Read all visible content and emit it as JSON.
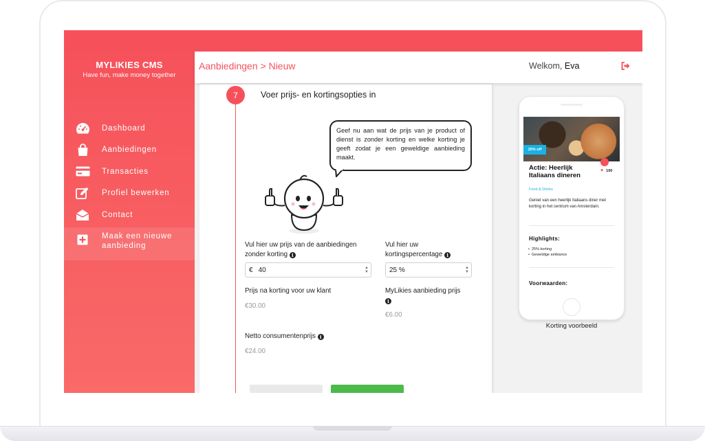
{
  "app": {
    "name": "MYLIKIES CMS",
    "tagline": "Have fun, make money together"
  },
  "sidebar": {
    "items": [
      {
        "label": "Dashboard",
        "icon": "speedometer-icon"
      },
      {
        "label": "Aanbiedingen",
        "icon": "shopping-bag-icon"
      },
      {
        "label": "Transacties",
        "icon": "credit-card-icon"
      },
      {
        "label": "Profiel bewerken",
        "icon": "edit-icon"
      },
      {
        "label": "Contact",
        "icon": "envelope-icon"
      }
    ],
    "new_offer_label": "Maak een nieuwe aanbieding"
  },
  "header": {
    "breadcrumb": "Aanbiedingen > Nieuw",
    "welcome_prefix": "Welkom,",
    "user_name": "Eva"
  },
  "step": {
    "number": "7",
    "title": "Voer prijs- en kortingsopties in",
    "speech": "Geef nu aan wat de prijs van je product of dienst is zonder korting en welke korting je geeft zodat je een geweldige aanbieding maakt."
  },
  "form": {
    "price_label": "Vul hier uw prijs van de aanbiedingen zonder korting",
    "currency_symbol": "€",
    "price_value": "40",
    "discount_label": "Vul hier uw kortingspercentage",
    "discount_value": "25 %",
    "price_after_label": "Prijs na korting voor uw klant",
    "price_after_value": "€30.00",
    "fee_label": "MyLikies aanbieding prijs",
    "fee_value": "€6.00",
    "net_label": "Netto consumentenprijs",
    "net_value": "€24.00"
  },
  "preview": {
    "discount_badge": "25% off",
    "likes": "100",
    "title": "Actie: Heerlijk Italiaans dineren",
    "category": "Food & Drinks",
    "description": "Geniet van een heerlijk Italiaans diner met korting in het centrum van Amsterdam.",
    "highlights_title": "Highlights:",
    "highlights": [
      "25% korting",
      "Geweldige ambiance"
    ],
    "terms_title": "Voorwaarden:",
    "caption": "Korting voorbeeld"
  },
  "colors": {
    "brand": "#f6515a",
    "accent_blue": "#1ab1e4",
    "confirm_green": "#4cba4a"
  }
}
